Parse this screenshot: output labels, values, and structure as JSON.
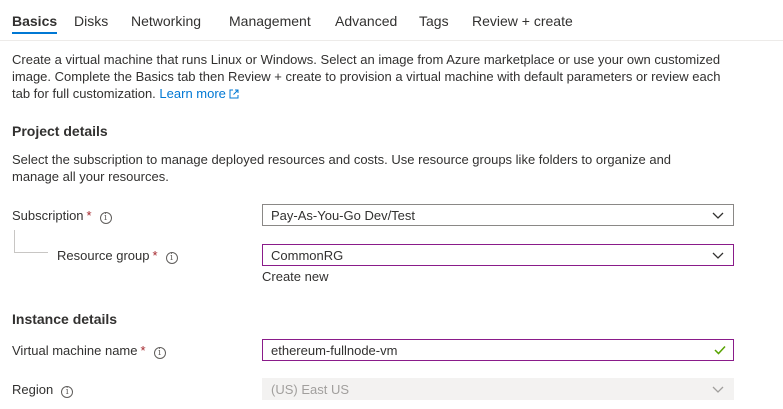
{
  "tabs": [
    {
      "label": "Basics",
      "active": true
    },
    {
      "label": "Disks"
    },
    {
      "label": "Networking"
    },
    {
      "label": "Management"
    },
    {
      "label": "Advanced"
    },
    {
      "label": "Tags"
    },
    {
      "label": "Review + create"
    }
  ],
  "intro": {
    "line1": "Create a virtual machine that runs Linux or Windows. Select an image from Azure marketplace or use your own customized",
    "line2": "image. Complete the Basics tab then Review + create to provision a virtual machine with default parameters or review each",
    "line3": "tab for full customization.",
    "learn_more": "Learn more"
  },
  "project": {
    "title": "Project details",
    "desc_line1": "Select the subscription to manage deployed resources and costs. Use resource groups like folders to organize and",
    "desc_line2": "manage all your resources.",
    "subscription": {
      "label": "Subscription",
      "required": "*",
      "value": "Pay-As-You-Go Dev/Test"
    },
    "resource_group": {
      "label": "Resource group",
      "required": "*",
      "value": "CommonRG",
      "create_new": "Create new"
    }
  },
  "instance": {
    "title": "Instance details",
    "vm_name": {
      "label": "Virtual machine name",
      "required": "*",
      "value": "ethereum-fullnode-vm"
    },
    "region": {
      "label": "Region",
      "value": "(US) East US"
    }
  },
  "icons": {
    "info": "i",
    "external": "external-link-icon",
    "chevron": "chevron-down-icon",
    "valid": "checkmark-icon"
  },
  "colors": {
    "accent": "#0078d4",
    "required": "#a4262c",
    "focus_border": "#8a1b8a",
    "valid": "#57a300"
  }
}
